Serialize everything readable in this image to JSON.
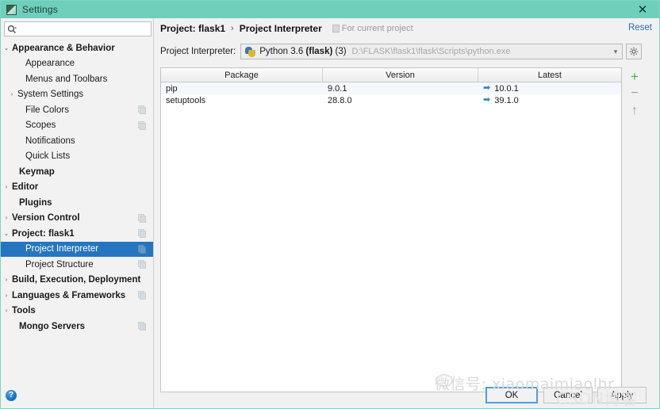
{
  "window": {
    "title": "Settings",
    "icon": "settings-window-icon",
    "close_label": "✕",
    "titlebar_color": "#6ecfbb"
  },
  "sidebar": {
    "search": {
      "placeholder": "",
      "value": "",
      "icon": "search-icon"
    },
    "help_label": "?",
    "items": [
      {
        "label": "Appearance & Behavior",
        "arrow": "⌄",
        "bold": true,
        "indent": 4,
        "scope_icon": false,
        "selected": false
      },
      {
        "label": "Appearance",
        "arrow": "",
        "bold": false,
        "indent": 21,
        "scope_icon": false,
        "selected": false
      },
      {
        "label": "Menus and Toolbars",
        "arrow": "",
        "bold": false,
        "indent": 21,
        "scope_icon": false,
        "selected": false
      },
      {
        "label": "System Settings",
        "arrow": "›",
        "bold": false,
        "indent": 11,
        "scope_icon": false,
        "selected": false
      },
      {
        "label": "File Colors",
        "arrow": "",
        "bold": false,
        "indent": 21,
        "scope_icon": true,
        "selected": false
      },
      {
        "label": "Scopes",
        "arrow": "",
        "bold": false,
        "indent": 21,
        "scope_icon": true,
        "selected": false
      },
      {
        "label": "Notifications",
        "arrow": "",
        "bold": false,
        "indent": 21,
        "scope_icon": false,
        "selected": false
      },
      {
        "label": "Quick Lists",
        "arrow": "",
        "bold": false,
        "indent": 21,
        "scope_icon": false,
        "selected": false
      },
      {
        "label": "Keymap",
        "arrow": "",
        "bold": true,
        "indent": 13,
        "scope_icon": false,
        "selected": false
      },
      {
        "label": "Editor",
        "arrow": "›",
        "bold": true,
        "indent": 4,
        "scope_icon": false,
        "selected": false
      },
      {
        "label": "Plugins",
        "arrow": "",
        "bold": true,
        "indent": 13,
        "scope_icon": false,
        "selected": false
      },
      {
        "label": "Version Control",
        "arrow": "›",
        "bold": true,
        "indent": 4,
        "scope_icon": true,
        "selected": false
      },
      {
        "label": "Project: flask1",
        "arrow": "⌄",
        "bold": true,
        "indent": 4,
        "scope_icon": true,
        "selected": false
      },
      {
        "label": "Project Interpreter",
        "arrow": "",
        "bold": false,
        "indent": 21,
        "scope_icon": true,
        "selected": true
      },
      {
        "label": "Project Structure",
        "arrow": "",
        "bold": false,
        "indent": 21,
        "scope_icon": true,
        "selected": false
      },
      {
        "label": "Build, Execution, Deployment",
        "arrow": "›",
        "bold": true,
        "indent": 4,
        "scope_icon": false,
        "selected": false
      },
      {
        "label": "Languages & Frameworks",
        "arrow": "›",
        "bold": true,
        "indent": 4,
        "scope_icon": true,
        "selected": false
      },
      {
        "label": "Tools",
        "arrow": "›",
        "bold": true,
        "indent": 4,
        "scope_icon": false,
        "selected": false
      },
      {
        "label": "Mongo Servers",
        "arrow": "",
        "bold": true,
        "indent": 13,
        "scope_icon": true,
        "selected": false
      }
    ]
  },
  "main": {
    "breadcrumb": {
      "project": "Project: flask1",
      "separator": "›",
      "page": "Project Interpreter",
      "note": "For current project",
      "note_icon": "scope-icon"
    },
    "reset_label": "Reset",
    "interpreter": {
      "label": "Project Interpreter:",
      "icon": "python-icon",
      "name_prefix": "Python 3.6 ",
      "name_bold": "(flask)",
      "name_suffix": " (3)",
      "path": "D:\\FLASK\\flask1\\flask\\Scripts\\python.exe",
      "dropdown_icon": "chevron-down-icon",
      "gear_icon": "gear-icon"
    },
    "table": {
      "columns": [
        "Package",
        "Version",
        "Latest"
      ],
      "rows": [
        {
          "package": "pip",
          "version": "9.0.1",
          "latest": "10.0.1",
          "latest_icon": "➡"
        },
        {
          "package": "setuptools",
          "version": "28.8.0",
          "latest": "39.1.0",
          "latest_icon": "➡"
        }
      ]
    },
    "tools": [
      {
        "name": "add-package-button",
        "glyph": "+",
        "color": "#4caf50"
      },
      {
        "name": "remove-package-button",
        "glyph": "−",
        "color": "#9a9a9a"
      },
      {
        "name": "upgrade-package-button",
        "glyph": "↑",
        "color": "#9a9a9a"
      }
    ]
  },
  "footer": {
    "ok_label": "OK",
    "cancel_label": "Cancel",
    "apply_label": "Apply"
  },
  "watermarks": {
    "wechat": "微信号: xiaomaimiaolhr",
    "csdn": "CSDN博客"
  }
}
